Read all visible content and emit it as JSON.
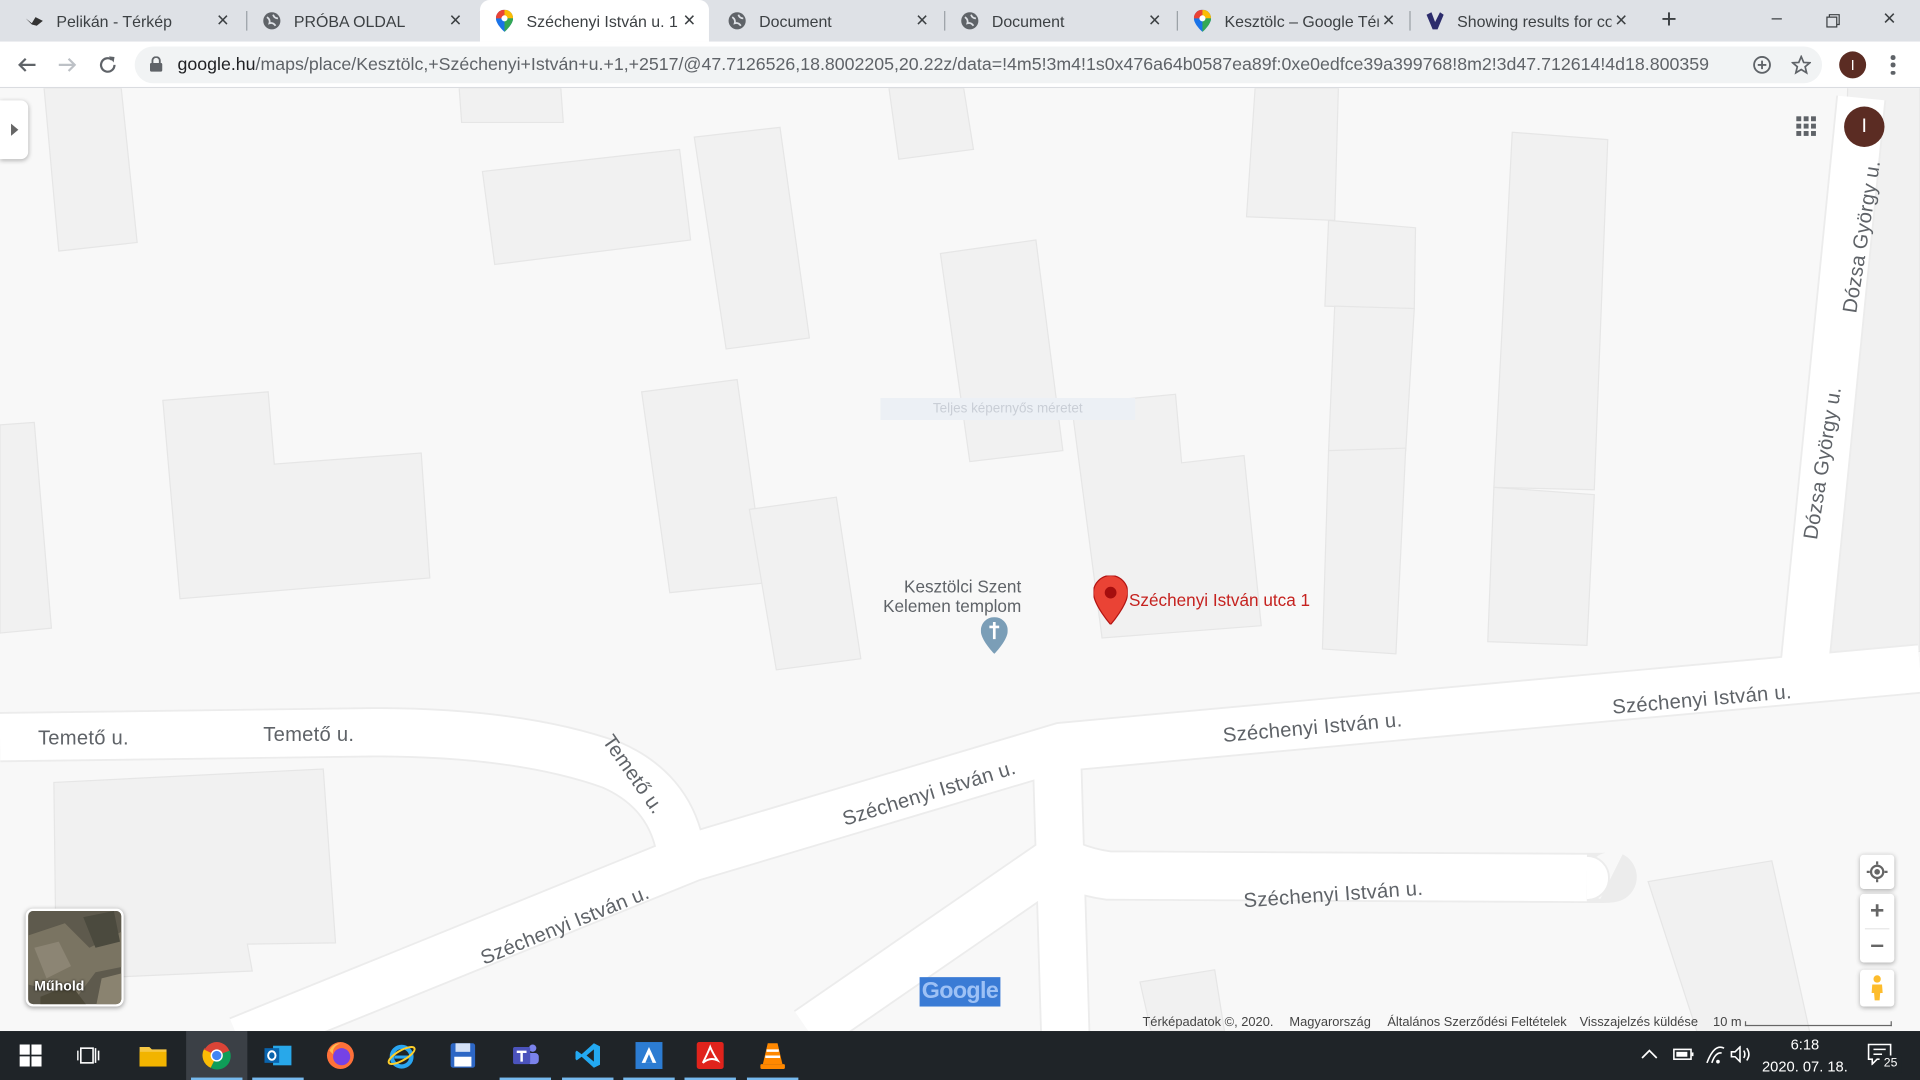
{
  "browser": {
    "tabs": [
      {
        "title": "Pelikán - Térkép",
        "icon": "pelikan-icon",
        "active": false
      },
      {
        "title": "PRÓBA OLDAL",
        "icon": "globe-icon",
        "active": false
      },
      {
        "title": "Széchenyi István u. 1 –",
        "icon": "maps-pin-icon",
        "active": true
      },
      {
        "title": "Document",
        "icon": "globe-icon",
        "active": false
      },
      {
        "title": "Document",
        "icon": "globe-icon",
        "active": false
      },
      {
        "title": "Kesztölc – Google Térk",
        "icon": "maps-pin-icon",
        "active": false
      },
      {
        "title": "Showing results for cor",
        "icon": "visual-studio-icon",
        "active": false
      }
    ],
    "url_domain": "google.hu",
    "url_path": "/maps/place/Kesztölc,+Széchenyi+István+u.+1,+2517/@47.7126526,18.8002205,20.22z/data=!4m5!3m4!1s0x476a64b0587ea89f:0xe0edfce39a399768!8m2!3d47.712614!4d18.800359",
    "profile_initial": "I"
  },
  "map": {
    "account_initial": "I",
    "road_labels": {
      "temeto_left": "Temető u.",
      "temeto_mid": "Temető u.",
      "temeto_curve": "Temető u.",
      "szechenyi_1": "Széchenyi István u.",
      "szechenyi_2": "Széchenyi István u.",
      "szechenyi_3": "Széchenyi István u.",
      "szechenyi_4": "Széchenyi István u.",
      "szechenyi_5": "Széchenyi István u.",
      "dozsa_1": "Dózsa György u.",
      "dozsa_2": "Dózsa György u."
    },
    "poi": {
      "line1": "Kesztölci Szent",
      "line2": "Kelemen templom"
    },
    "selected_place": "Széchenyi István utca 1",
    "fullscreen_tip": "Teljes képernyős méretet",
    "satellite_label": "Műhold",
    "google_logo": "Google",
    "footer": {
      "map_data": "Térképadatok ©, 2020.",
      "country": "Magyarország",
      "terms": "Általános Szerződési Feltételek",
      "feedback": "Visszajelzés küldése",
      "scale": "10 m"
    }
  },
  "taskbar": {
    "time": "6:18",
    "date": "2020. 07. 18.",
    "notification_count": "25"
  }
}
